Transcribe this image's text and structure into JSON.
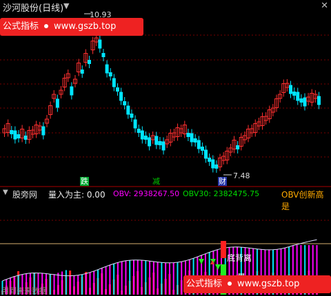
{
  "header": {
    "title": "沙河股份(日线)",
    "collapse_glyph": "▼",
    "close_glyph": "✕"
  },
  "watermark": {
    "left": "公式指标",
    "right": "www.gszb.top"
  },
  "price_panel": {
    "high_label": "10.93",
    "low_label": "7.48",
    "signal_die": "跌",
    "signal_jian": "减",
    "signal_cai": "财"
  },
  "indicator_bar": {
    "collapse_glyph": "▼",
    "name": "股旁网",
    "volume_main": "量入为主: 0.00",
    "obv": "OBV: 2938267.50",
    "obv30": "OBV30: 2382475.75",
    "obv_new_high": "OBV创新高是"
  },
  "indicator_panel": {
    "divergence_label": "底背离",
    "liang_label": "量",
    "no_data": "用到未来数据"
  },
  "colors": {
    "up": "#ff3030",
    "down": "#00e5ff",
    "grid": "#7a0000",
    "ind_line": "#ffd080",
    "obv_bar": "#ff00ff",
    "vol_bar": "#ff2020"
  }
}
